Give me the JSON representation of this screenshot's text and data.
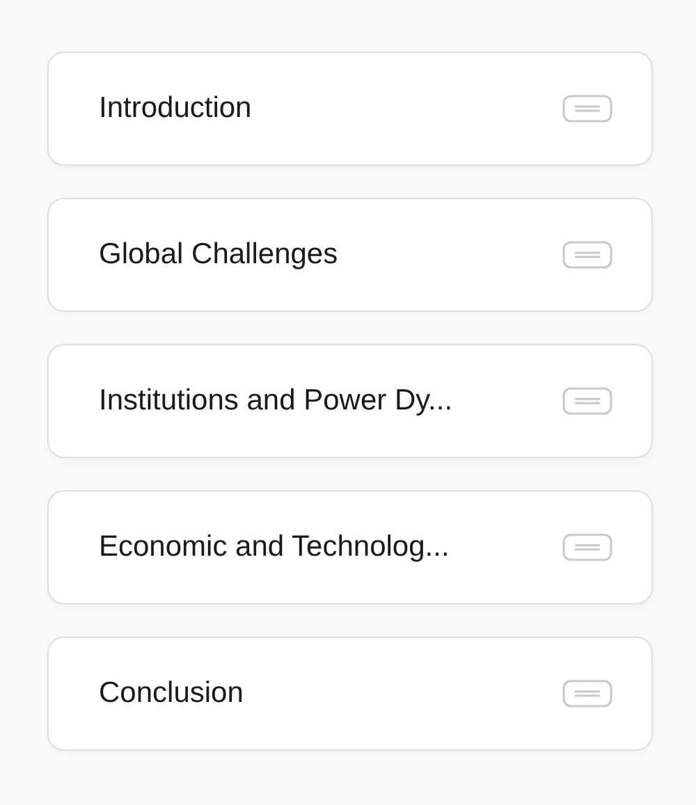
{
  "sections": [
    {
      "title": "Introduction"
    },
    {
      "title": "Global Challenges"
    },
    {
      "title": "Institutions and Power Dy..."
    },
    {
      "title": "Economic and Technolog..."
    },
    {
      "title": "Conclusion"
    }
  ]
}
